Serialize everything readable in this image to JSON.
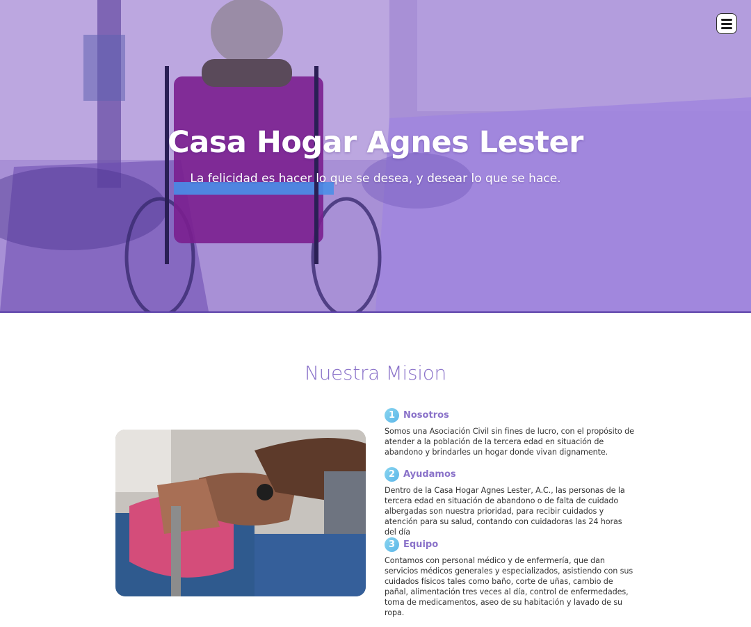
{
  "hero": {
    "title": "Casa Hogar Agnes Lester",
    "subtitle": "La felicidad es hacer lo que se desea, y desear lo que se hace.",
    "menu_icon": "hamburger-menu-icon",
    "overlay_color": "#8a6ae0"
  },
  "mission": {
    "title": "Nuestra Mision",
    "items": [
      {
        "number": "1",
        "title": "Nosotros",
        "text": "Somos una Asociación Civil sin fines de lucro, con el propósito de atender a la población de la tercera edad en situación de abandono y brindarles un hogar donde vivan dignamente."
      },
      {
        "number": "2",
        "title": "Ayudamos",
        "text": "Dentro de la Casa Hogar Agnes Lester, A.C., las personas de la tercera edad en situación de abandono o de falta de cuidado albergadas son nuestra prioridad, para recibir cuidados y atención para su salud, contando con cuidadoras las 24 horas del día"
      },
      {
        "number": "3",
        "title": "Equipo",
        "text": "Contamos con personal médico y de enfermería, que dan servicios médicos generales y especializados, asistiendo con sus cuidados físicos tales como baño, corte de uñas, cambio de pañal, alimentación tres veces al día, control de enfermedades, toma de medicamentos, aseo de su habitación y lavado de su ropa."
      }
    ]
  },
  "colors": {
    "accent": "#8a72c9",
    "badge": "#5cb6e8"
  }
}
